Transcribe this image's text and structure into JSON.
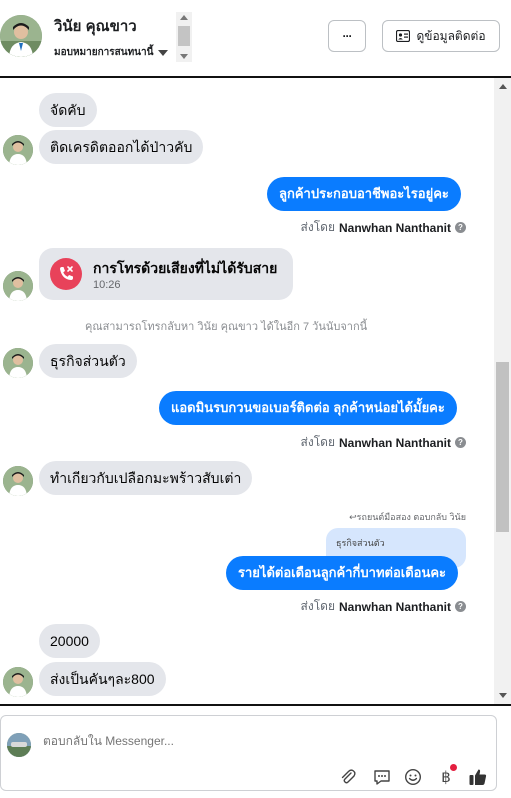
{
  "header": {
    "contact_name": "วินัย คุณขาว",
    "assign_label": "มอบหมายการสนทนานี้",
    "more_label": "···",
    "view_contact_label": "ดูข้อมูลติดต่อ"
  },
  "messages": {
    "m1": "จัดคับ",
    "m2": "ติดเครดิตออกได้ป่าวคับ",
    "m3": "ลูกค้าประกอบอาชีพอะไรอยู่คะ",
    "m4": "ธุรกิจส่วนตัว",
    "m5": "แอดมินรบกวนขอเบอร์ติดต่อ ลุกค้าหน่อยได้มั้ยคะ",
    "m6": "ทำเกียวกับเปลือกมะพร้าวสับเต่า",
    "m7": "รายได้ต่อเดือนลูกค้ากี่บาทต่อเดือนคะ",
    "m8": "20000",
    "m9": "ส่งเป็นคันๆละ800"
  },
  "sent_by": {
    "prefix": "ส่งโดย",
    "name": "Nanwhan Nanthanit"
  },
  "call": {
    "title": "การโทรด้วยเสียงที่ไม่ได้รับสาย",
    "time": "10:26"
  },
  "system_note": "คุณสามารถโทรกลับหา วินัย คุณขาว ได้ในอีก 7 วันนับจากนี้",
  "reply_context": {
    "label": "↩รถยนต์มือสอง ตอบกลับ วินัย",
    "quoted": "ธุรกิจส่วนตัว"
  },
  "composer": {
    "placeholder": "ตอบกลับใน Messenger..."
  },
  "colors": {
    "outgoing_bubble": "#0a7cff",
    "incoming_bubble": "#e4e6eb",
    "missed_call": "#e8425a",
    "notification_dot": "#e41e3f"
  }
}
